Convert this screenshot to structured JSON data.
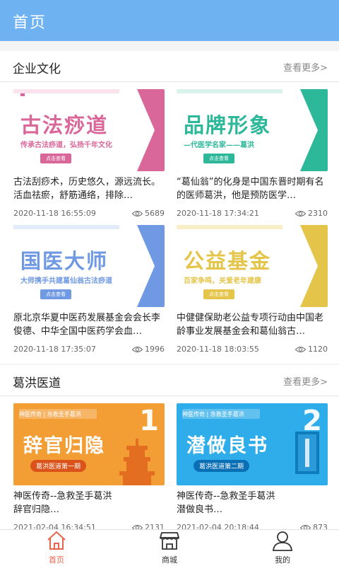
{
  "header": {
    "title": "首页"
  },
  "section_culture": {
    "title": "企业文化",
    "more": "查看更多>",
    "cards": [
      {
        "banner_title": "古法痧道",
        "banner_sub": "传承古法痧道，弘扬千年文化",
        "banner_btn": "点击查看",
        "accent": "#d9679a",
        "desc": "古法刮痧术，历史悠久，源远流长。活血祛瘀，舒筋通络，排除…",
        "date": "2020-11-18 16:55:09",
        "views": "5689"
      },
      {
        "banner_title": "品牌形象",
        "banner_sub": "—代医学名家——葛洪",
        "banner_btn": "点击查看",
        "accent": "#2db89a",
        "desc": "“葛仙翁”的化身是中国东晋时期有名的医师葛洪，他是预防医学…",
        "date": "2020-11-18 17:34:21",
        "views": "2310"
      },
      {
        "banner_title": "国医大师",
        "banner_sub": "大师携手共建葛仙翁古法痧道",
        "banner_btn": "点击查看",
        "accent": "#6f99e2",
        "desc": "原北京华夏中医药发展基金会会长李俊德、中华全国中医药学会血…",
        "date": "2020-11-18 17:35:07",
        "views": "1996"
      },
      {
        "banner_title": "公益基金",
        "banner_sub": "百家争鸣，关爱老年建康",
        "banner_btn": "点击查看",
        "accent": "#e4c54a",
        "desc": "中健健保助老公益专项行动由中国老龄事业发展基金会和葛仙翁古…",
        "date": "2020-11-18 18:03:55",
        "views": "1120"
      }
    ]
  },
  "section_medicine": {
    "title": "葛洪医道",
    "more": "查看更多>",
    "cards": [
      {
        "tag": "神医传奇 | 急救圣手葛洪",
        "banner_title": "辞官归隐",
        "period": "葛洪医道第一期",
        "num": "1",
        "accent": "#f2922a",
        "desc": "神医传奇--急救圣手葛洪\n辞官归隐…",
        "date": "2021-02-04 16:34:51",
        "views": "2131"
      },
      {
        "tag": "神医传奇 | 急救圣手葛洪",
        "banner_title": "潜做良书",
        "period": "葛洪医道第二期",
        "num": "2",
        "accent": "#1fa0e6",
        "desc": "神医传奇--急救圣手葛洪\n潜做良书…",
        "date": "2021-02-04 20:18:44",
        "views": "873"
      }
    ]
  },
  "tabbar": {
    "items": [
      {
        "label": "首页",
        "icon": "home-icon",
        "active": true
      },
      {
        "label": "商城",
        "icon": "shop-icon",
        "active": false
      },
      {
        "label": "我的",
        "icon": "user-icon",
        "active": false
      }
    ],
    "active_color": "#e5654d"
  }
}
